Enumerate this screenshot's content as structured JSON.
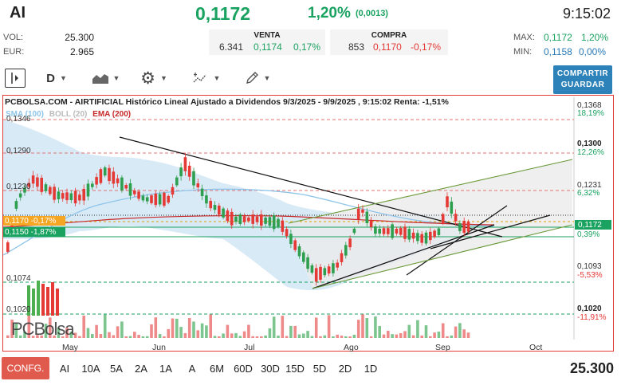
{
  "header": {
    "ticker": "AI",
    "price": "0,1172",
    "change_pct": "1,20%",
    "change_abs": "(0,0013)",
    "time": "9:15:02"
  },
  "stats": {
    "vol_label": "VOL:",
    "vol_value": "25.300",
    "eur_label": "EUR:",
    "eur_value": "2.965",
    "max_label": "MAX:",
    "max_value": "0,1172",
    "max_pct": "1,20%",
    "min_label": "MIN:",
    "min_value": "0,1158",
    "min_pct": "0,00%"
  },
  "book": {
    "sell_title": "VENTA",
    "sell_qty": "6.341",
    "sell_price": "0,1174",
    "sell_pct": "0,17%",
    "buy_title": "COMPRA",
    "buy_qty": "853",
    "buy_price": "0,1170",
    "buy_pct": "-0,17%"
  },
  "toolbar": {
    "period": "D",
    "share_label": "COMPARTIR GUARDAR"
  },
  "chart": {
    "title": "PCBOLSA.COM - AIRTIFICIAL Histórico Lineal Ajustado a Dividendos 9/3/2025 - 9/9/2025 , 9:15:02 Renta: -1,51%",
    "legend_sma": "SMA (100)",
    "legend_boll": "BOLL (20)",
    "legend_ema": "EMA (200)",
    "left_labels": [
      "0,1346",
      "0,1290",
      "0,1230",
      "0,1074",
      "0,1020"
    ],
    "tag_1170": "0,1170 -0,17%",
    "tag_1150": "0,1150 -1,87%",
    "right_labels": [
      {
        "v": "0,1368",
        "p": "18,19%",
        "c": "#1aa260"
      },
      {
        "v": "0,1300",
        "p": "12,26%",
        "c": "#1aa260"
      },
      {
        "v": "0,1231",
        "p": "6,32%",
        "c": "#1aa260"
      },
      {
        "v": "0,1172",
        "p": "",
        "c": "#1aa260"
      },
      {
        "v": "",
        "p": "0,39%",
        "c": "#1aa260"
      },
      {
        "v": "0,1093",
        "p": "-5,53%",
        "c": "#e53935"
      },
      {
        "v": "0,1020",
        "p": "-11,91%",
        "c": "#e53935"
      }
    ],
    "months": [
      "May",
      "Jun",
      "Jul",
      "Ago",
      "Sep",
      "Oct"
    ],
    "watermark": "PCBolsa"
  },
  "periods": [
    "AI",
    "10A",
    "5A",
    "2A",
    "1A",
    "A",
    "6M",
    "60D",
    "30D",
    "15D",
    "5D",
    "2D",
    "1D"
  ],
  "footer": {
    "config_label": "CONFG.",
    "volume": "25.300"
  }
}
